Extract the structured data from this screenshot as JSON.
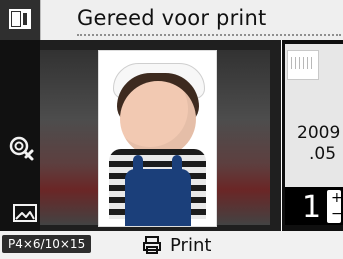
{
  "header": {
    "title": "Gereed voor print"
  },
  "left_toolbar": {
    "icons": [
      {
        "name": "lens-off-icon"
      },
      {
        "name": "picture-frame-icon"
      }
    ]
  },
  "preview": {
    "image_label": "",
    "date": {
      "year": "2009",
      "month": ".05"
    }
  },
  "quantity": {
    "value": "1",
    "plus": "+",
    "minus": "−"
  },
  "bottom": {
    "paper_size": "P4×6/10×15",
    "print_label": "Print"
  },
  "colors": {
    "bar_bg": "#efefef",
    "main_bg": "#1f1f1f",
    "accent_black": "#000000",
    "pill_bg": "#2d2d2d"
  }
}
